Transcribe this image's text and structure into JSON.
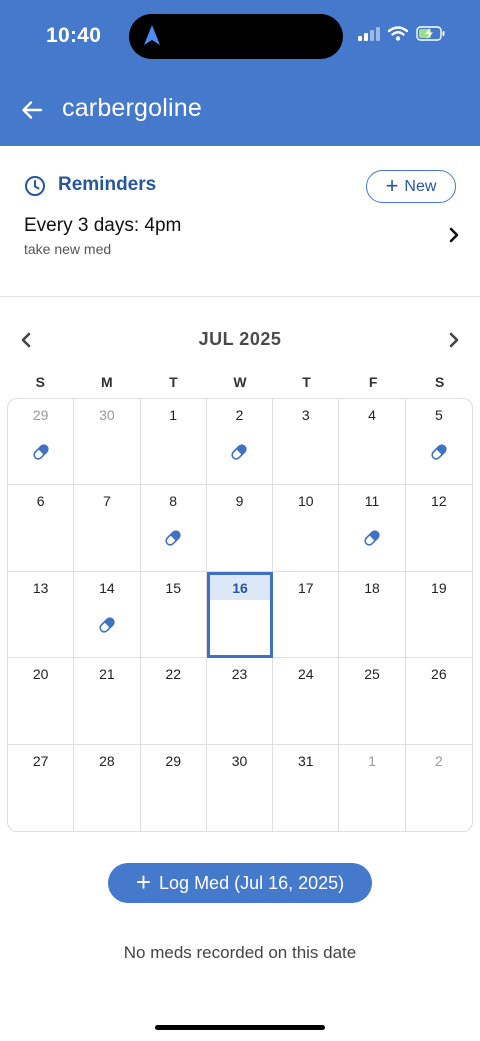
{
  "status_bar": {
    "time": "10:40"
  },
  "nav": {
    "title": "carbergoline"
  },
  "reminders": {
    "title": "Reminders",
    "new_label": "New",
    "item": {
      "schedule": "Every 3 days: 4pm",
      "note": "take new med"
    }
  },
  "calendar": {
    "month_label": "JUL 2025",
    "weekdays": [
      "S",
      "M",
      "T",
      "W",
      "T",
      "F",
      "S"
    ],
    "selected_day": "16",
    "weeks": [
      [
        {
          "day": "29",
          "other_month": true,
          "med": true
        },
        {
          "day": "30",
          "other_month": true,
          "med": false
        },
        {
          "day": "1",
          "med": false
        },
        {
          "day": "2",
          "med": true
        },
        {
          "day": "3",
          "med": false
        },
        {
          "day": "4",
          "med": false
        },
        {
          "day": "5",
          "med": true
        }
      ],
      [
        {
          "day": "6",
          "med": false
        },
        {
          "day": "7",
          "med": false
        },
        {
          "day": "8",
          "med": true
        },
        {
          "day": "9",
          "med": false
        },
        {
          "day": "10",
          "med": false
        },
        {
          "day": "11",
          "med": true
        },
        {
          "day": "12",
          "med": false
        }
      ],
      [
        {
          "day": "13",
          "med": false
        },
        {
          "day": "14",
          "med": true
        },
        {
          "day": "15",
          "med": false
        },
        {
          "day": "16",
          "med": false,
          "selected": true
        },
        {
          "day": "17",
          "med": false
        },
        {
          "day": "18",
          "med": false
        },
        {
          "day": "19",
          "med": false
        }
      ],
      [
        {
          "day": "20",
          "med": false
        },
        {
          "day": "21",
          "med": false
        },
        {
          "day": "22",
          "med": false
        },
        {
          "day": "23",
          "med": false
        },
        {
          "day": "24",
          "med": false
        },
        {
          "day": "25",
          "med": false
        },
        {
          "day": "26",
          "med": false
        }
      ],
      [
        {
          "day": "27",
          "med": false
        },
        {
          "day": "28",
          "med": false
        },
        {
          "day": "29",
          "med": false
        },
        {
          "day": "30",
          "med": false
        },
        {
          "day": "31",
          "med": false
        },
        {
          "day": "1",
          "other_month": true,
          "med": false
        },
        {
          "day": "2",
          "other_month": true,
          "med": false
        }
      ]
    ]
  },
  "log_button": {
    "label": "Log Med (Jul 16, 2025)"
  },
  "empty_state": {
    "text": "No meds recorded on this date"
  },
  "colors": {
    "header": "#4479cc",
    "accent_text": "#26569f",
    "today_fill": "#dce8f7",
    "pill_blue": "#3f72c2"
  },
  "icons": {
    "back": "arrow-left-icon",
    "clock": "clock-icon",
    "plus": "plus-icon",
    "chevron_right": "chevron-right-icon",
    "chevron_left": "chevron-left-icon",
    "pill": "pill-icon"
  }
}
